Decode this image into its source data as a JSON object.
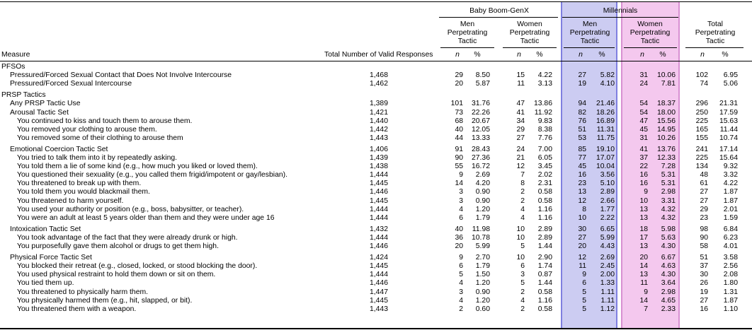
{
  "header": {
    "group1": "Baby Boom-GenX",
    "group2": "Millennials",
    "col_measure": "Measure",
    "col_total_valid": "Total Number of Valid Responses",
    "sub": [
      {
        "lines": [
          "Men",
          "Perpetrating",
          "Tactic"
        ]
      },
      {
        "lines": [
          "Women",
          "Perpetrating",
          "Tactic"
        ]
      },
      {
        "lines": [
          "Men",
          "Perpetrating",
          "Tactic"
        ]
      },
      {
        "lines": [
          "Women",
          "Perpetrating",
          "Tactic"
        ]
      },
      {
        "lines": [
          "Total",
          "Perpetrating",
          "Tactic"
        ]
      }
    ],
    "n_label": "n",
    "pct_label": "%"
  },
  "colors": {
    "millennial_men_fill": "#ccccf2",
    "millennial_women_fill": "#f4c8ee"
  },
  "rows": [
    {
      "label": "PFSOs",
      "level": 0,
      "section": true
    },
    {
      "label": "Pressured/Forced Sexual Contact that Does Not Involve Intercourse",
      "level": 1,
      "total": "1,468",
      "v": [
        "29",
        "8.50",
        "15",
        "4.22",
        "27",
        "5.82",
        "31",
        "10.06",
        "102",
        "6.95"
      ]
    },
    {
      "label": "Pressured/Forced Sexual Intercourse",
      "level": 1,
      "total": "1,462",
      "v": [
        "20",
        "5.87",
        "11",
        "3.13",
        "19",
        "4.10",
        "24",
        "7.81",
        "74",
        "5.06"
      ]
    },
    {
      "label": "PRSP Tactics",
      "level": 0,
      "section": true,
      "gap": true
    },
    {
      "label": "Any PRSP Tactic Use",
      "level": 1,
      "total": "1,389",
      "v": [
        "101",
        "31.76",
        "47",
        "13.86",
        "94",
        "21.46",
        "54",
        "18.37",
        "296",
        "21.31"
      ]
    },
    {
      "label": "Arousal Tactic Set",
      "level": 1,
      "total": "1,421",
      "v": [
        "73",
        "22.26",
        "41",
        "11.92",
        "82",
        "18.26",
        "54",
        "18.00",
        "250",
        "17.59"
      ]
    },
    {
      "label": "You continued to kiss and touch them to arouse them.",
      "level": 2,
      "total": "1,440",
      "v": [
        "68",
        "20.67",
        "34",
        "9.83",
        "76",
        "16.89",
        "47",
        "15.56",
        "225",
        "15.63"
      ]
    },
    {
      "label": "You removed your clothing to arouse them.",
      "level": 2,
      "total": "1,442",
      "v": [
        "40",
        "12.05",
        "29",
        "8.38",
        "51",
        "11.31",
        "45",
        "14.95",
        "165",
        "11.44"
      ]
    },
    {
      "label": "You removed some of their clothing to arouse them",
      "level": 2,
      "total": "1,443",
      "v": [
        "44",
        "13.33",
        "27",
        "7.76",
        "53",
        "11.75",
        "31",
        "10.26",
        "155",
        "10.74"
      ]
    },
    {
      "label": "Emotional Coercion Tactic Set",
      "level": 1,
      "total": "1,406",
      "gap": true,
      "v": [
        "91",
        "28.43",
        "24",
        "7.00",
        "85",
        "19.10",
        "41",
        "13.76",
        "241",
        "17.14"
      ]
    },
    {
      "label": "You tried to talk them into it by repeatedly asking.",
      "level": 2,
      "total": "1,439",
      "v": [
        "90",
        "27.36",
        "21",
        "6.05",
        "77",
        "17.07",
        "37",
        "12.33",
        "225",
        "15.64"
      ]
    },
    {
      "label": "You told them a lie of some kind (e.g., how much you liked or loved them).",
      "level": 2,
      "total": "1,438",
      "v": [
        "55",
        "16.72",
        "12",
        "3.45",
        "45",
        "10.04",
        "22",
        "7.28",
        "134",
        "9.32"
      ]
    },
    {
      "label": "You questioned their sexuality (e.g., you called them frigid/impotent or gay/lesbian).",
      "level": 2,
      "total": "1,444",
      "v": [
        "9",
        "2.69",
        "7",
        "2.02",
        "16",
        "3.56",
        "16",
        "5.31",
        "48",
        "3.32"
      ]
    },
    {
      "label": "You threatened to break up with them.",
      "level": 2,
      "total": "1,445",
      "v": [
        "14",
        "4.20",
        "8",
        "2.31",
        "23",
        "5.10",
        "16",
        "5.31",
        "61",
        "4.22"
      ]
    },
    {
      "label": "You told them you would blackmail them.",
      "level": 2,
      "total": "1,446",
      "v": [
        "3",
        "0.90",
        "2",
        "0.58",
        "13",
        "2.89",
        "9",
        "2.98",
        "27",
        "1.87"
      ]
    },
    {
      "label": "You threatened to harm yourself.",
      "level": 2,
      "total": "1,445",
      "v": [
        "3",
        "0.90",
        "2",
        "0.58",
        "12",
        "2.66",
        "10",
        "3.31",
        "27",
        "1.87"
      ]
    },
    {
      "label": "You used your authority or position (e.g., boss, babysitter, or teacher).",
      "level": 2,
      "total": "1,444",
      "v": [
        "4",
        "1.20",
        "4",
        "1.16",
        "8",
        "1.77",
        "13",
        "4.32",
        "29",
        "2.01"
      ]
    },
    {
      "label": "You were an adult at least 5 years older than them and they were under age 16",
      "level": 2,
      "total": "1,444",
      "v": [
        "6",
        "1.79",
        "4",
        "1.16",
        "10",
        "2.22",
        "13",
        "4.32",
        "23",
        "1.59"
      ]
    },
    {
      "label": "Intoxication Tactic Set",
      "level": 1,
      "total": "1,432",
      "gap": true,
      "v": [
        "40",
        "11.98",
        "10",
        "2.89",
        "30",
        "6.65",
        "18",
        "5.98",
        "98",
        "6.84"
      ]
    },
    {
      "label": "You took advantage of the fact that they were already drunk or high.",
      "level": 2,
      "total": "1,444",
      "v": [
        "36",
        "10.78",
        "10",
        "2.89",
        "27",
        "5.99",
        "17",
        "5.63",
        "90",
        "6.23"
      ]
    },
    {
      "label": "You purposefully gave them alcohol or drugs to get them high.",
      "level": 2,
      "total": "1,446",
      "v": [
        "20",
        "5.99",
        "5",
        "1.44",
        "20",
        "4.43",
        "13",
        "4.30",
        "58",
        "4.01"
      ]
    },
    {
      "label": "Physical Force Tactic Set",
      "level": 1,
      "total": "1,424",
      "gap": true,
      "v": [
        "9",
        "2.70",
        "10",
        "2.90",
        "12",
        "2.69",
        "20",
        "6.67",
        "51",
        "3.58"
      ]
    },
    {
      "label": "You blocked their retreat (e.g., closed, locked, or stood blocking the door).",
      "level": 2,
      "total": "1,445",
      "v": [
        "6",
        "1.79",
        "6",
        "1.74",
        "11",
        "2.45",
        "14",
        "4.63",
        "37",
        "2.56"
      ]
    },
    {
      "label": "You used physical restraint to hold them down or sit on them.",
      "level": 2,
      "total": "1,444",
      "v": [
        "5",
        "1.50",
        "3",
        "0.87",
        "9",
        "2.00",
        "13",
        "4.30",
        "30",
        "2.08"
      ]
    },
    {
      "label": "You tied them up.",
      "level": 2,
      "total": "1,446",
      "v": [
        "4",
        "1.20",
        "5",
        "1.44",
        "6",
        "1.33",
        "11",
        "3.64",
        "26",
        "1.80"
      ]
    },
    {
      "label": "You threatened to physically harm them.",
      "level": 2,
      "total": "1,447",
      "v": [
        "3",
        "0.90",
        "2",
        "0.58",
        "5",
        "1.11",
        "9",
        "2.98",
        "19",
        "1.31"
      ]
    },
    {
      "label": "You physically harmed them (e.g., hit, slapped, or bit).",
      "level": 2,
      "total": "1,445",
      "v": [
        "4",
        "1.20",
        "4",
        "1.16",
        "5",
        "1.11",
        "14",
        "4.65",
        "27",
        "1.87"
      ]
    },
    {
      "label": "You threatened them with a weapon.",
      "level": 2,
      "total": "1,443",
      "v": [
        "2",
        "0.60",
        "2",
        "0.58",
        "5",
        "1.12",
        "7",
        "2.33",
        "16",
        "1.10"
      ]
    }
  ]
}
